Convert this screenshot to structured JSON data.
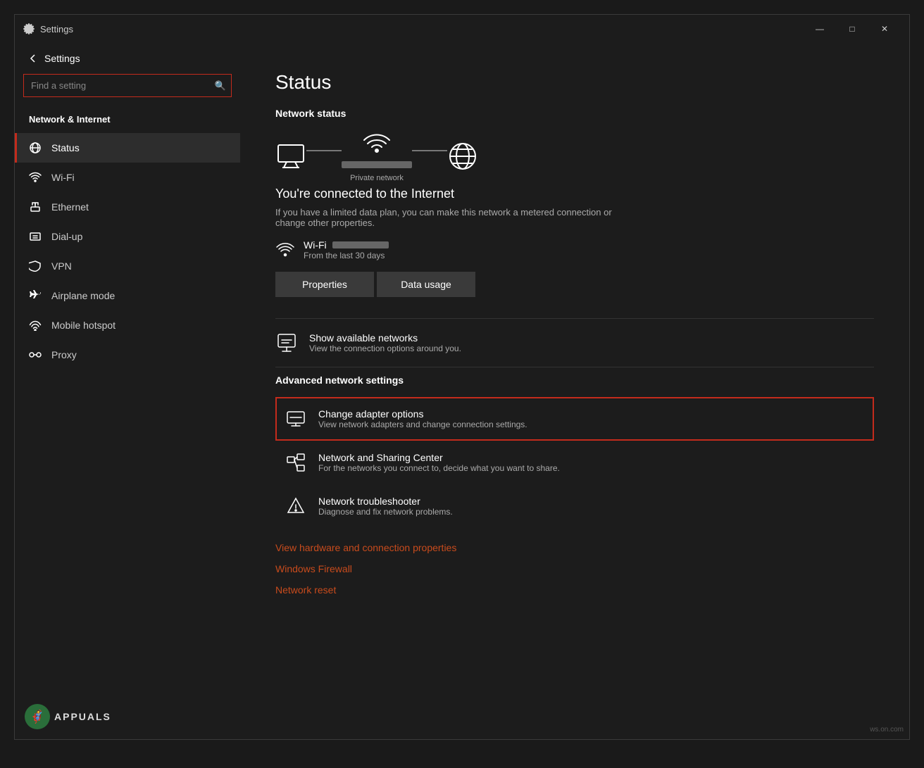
{
  "window": {
    "title": "Settings",
    "controls": {
      "minimize": "—",
      "maximize": "□",
      "close": "✕"
    }
  },
  "sidebar": {
    "back_label": "Back",
    "search_placeholder": "Find a setting",
    "section_title": "Network & Internet",
    "items": [
      {
        "id": "status",
        "label": "Status",
        "icon": "globe",
        "active": true
      },
      {
        "id": "wifi",
        "label": "Wi-Fi",
        "icon": "wifi"
      },
      {
        "id": "ethernet",
        "label": "Ethernet",
        "icon": "ethernet"
      },
      {
        "id": "dialup",
        "label": "Dial-up",
        "icon": "dialup"
      },
      {
        "id": "vpn",
        "label": "VPN",
        "icon": "vpn"
      },
      {
        "id": "airplane",
        "label": "Airplane mode",
        "icon": "airplane"
      },
      {
        "id": "hotspot",
        "label": "Mobile hotspot",
        "icon": "hotspot"
      },
      {
        "id": "proxy",
        "label": "Proxy",
        "icon": "proxy"
      }
    ]
  },
  "main": {
    "page_title": "Status",
    "network_status_label": "Network status",
    "network_label": "Private network",
    "connected_text": "You're connected to the Internet",
    "connected_subtext": "If you have a limited data plan, you can make this network a metered connection or change other properties.",
    "wifi_name": "Wi-Fi",
    "wifi_name_blurred": true,
    "wifi_days": "From the last 30 days",
    "btn_properties": "Properties",
    "btn_data_usage": "Data usage",
    "show_networks_title": "Show available networks",
    "show_networks_subtitle": "View the connection options around you.",
    "advanced_title": "Advanced network settings",
    "advanced_items": [
      {
        "id": "change-adapter",
        "title": "Change adapter options",
        "subtitle": "View network adapters and change connection settings.",
        "highlighted": true
      },
      {
        "id": "sharing-center",
        "title": "Network and Sharing Center",
        "subtitle": "For the networks you connect to, decide what you want to share.",
        "highlighted": false
      },
      {
        "id": "troubleshooter",
        "title": "Network troubleshooter",
        "subtitle": "Diagnose and fix network problems.",
        "highlighted": false
      }
    ],
    "links": [
      "View hardware and connection properties",
      "Windows Firewall",
      "Network reset"
    ]
  },
  "watermark": "ws.on.com",
  "appuals_text": "APPUALS"
}
